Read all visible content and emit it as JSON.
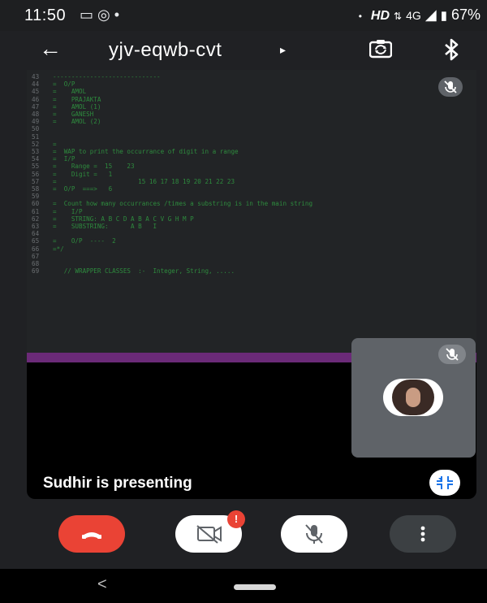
{
  "status_bar": {
    "time": "11:50",
    "left_icons": "▭ ◎ •",
    "right_dot": "•",
    "hd": "HD",
    "network": "4G",
    "battery": "67%"
  },
  "header": {
    "title": "yjv-eqwb-cvt",
    "caret": "▸",
    "back_icon": "arrow-back-icon",
    "switch_camera_icon": "switch-camera-icon",
    "bluetooth_icon": "bluetooth-icon"
  },
  "shared_screen": {
    "code_lines": [
      {
        "n": "43",
        "t": "-----------------------------"
      },
      {
        "n": "44",
        "t": "=  O/P"
      },
      {
        "n": "45",
        "t": "=    AMOL"
      },
      {
        "n": "46",
        "t": "=    PRAJAKTA"
      },
      {
        "n": "47",
        "t": "=    AMOL (1)"
      },
      {
        "n": "48",
        "t": "=    GANESH"
      },
      {
        "n": "49",
        "t": "=    AMOL (2)"
      },
      {
        "n": "50",
        "t": ""
      },
      {
        "n": "51",
        "t": ""
      },
      {
        "n": "52",
        "t": "="
      },
      {
        "n": "53",
        "t": "=  WAP to print the occurrance of digit in a range"
      },
      {
        "n": "54",
        "t": "=  I/P"
      },
      {
        "n": "55",
        "t": "=    Range =  15    23"
      },
      {
        "n": "56",
        "t": "=    Digit =   1"
      },
      {
        "n": "57",
        "t": "=                      15 16 17 18 19 20 21 22 23"
      },
      {
        "n": "58",
        "t": "=  O/P  ===>   6"
      },
      {
        "n": "59",
        "t": ""
      },
      {
        "n": "60",
        "t": "=  Count how many occurrances /times a substring is in the main string"
      },
      {
        "n": "61",
        "t": "=    I/P"
      },
      {
        "n": "62",
        "t": "=    STRING: A B C D A B A C V G H M P"
      },
      {
        "n": "63",
        "t": "=    SUBSTRING:      A B   I"
      },
      {
        "n": "64",
        "t": ""
      },
      {
        "n": "65",
        "t": "=    O/P  ----  2"
      },
      {
        "n": "66",
        "t": "=*/"
      },
      {
        "n": "67",
        "t": ""
      },
      {
        "n": "68",
        "t": ""
      },
      {
        "n": "69",
        "t": "   // WRAPPER CLASSES  :-  Integer, String, ....."
      }
    ],
    "presenting_text": "Sudhir is presenting"
  },
  "controls": {
    "camera_badge": "!",
    "end_call_icon": "phone-hangup-icon",
    "camera_icon": "camera-off-icon",
    "mic_icon": "mic-off-icon",
    "more_icon": "more-vert-icon"
  },
  "nav": {
    "back": "<"
  }
}
